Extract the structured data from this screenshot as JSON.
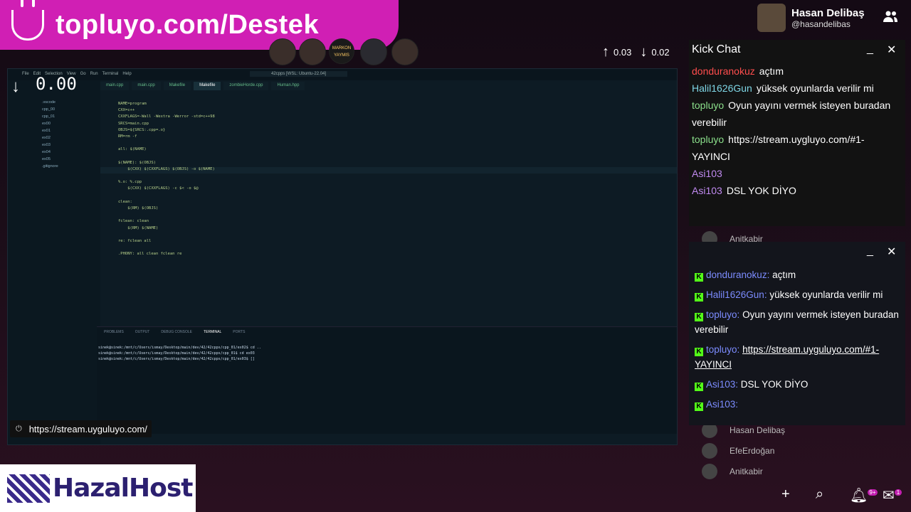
{
  "banner": {
    "text": "topluyo.com/Destek"
  },
  "profile": {
    "name": "Hasan Delibaş",
    "handle": "@hasandelibas"
  },
  "stats": {
    "up": "0.03",
    "down": "0.02"
  },
  "counter": "0.00",
  "url_overlay": "https://stream.uyguluyo.com/",
  "avatar_labels": {
    "third": "MARKON\nYAYMIS"
  },
  "vscode": {
    "title": "42cpps [WSL: Ubuntu-22.04]",
    "menu": [
      "File",
      "Edit",
      "Selection",
      "View",
      "Go",
      "Run",
      "Terminal",
      "Help"
    ],
    "tabs": [
      "main.cpp",
      "main.cpp",
      "Makefile",
      "Makefile",
      "zombieHorde.cpp",
      "Human.hpp"
    ],
    "active_tab_index": 3,
    "sidebar": [
      ".vscode",
      "cpp_00",
      "cpp_01",
      "ex00",
      "ex01",
      "ex02",
      "ex03",
      "ex04",
      "ex05",
      ".gitignore"
    ],
    "code": [
      "NAME=program",
      "CXX=c++",
      "CXXFLAGS=-Wall -Wextra -Werror -std=c++98",
      "SRCS=main.cpp",
      "OBJS=${SRCS:.cpp=.o}",
      "RM=rm -f",
      "",
      "all: $(NAME)",
      "",
      "$(NAME): $(OBJS)",
      "    $(CXX) $(CXXFLAGS) $(OBJS) -o $(NAME)",
      "",
      "%.o: %.cpp",
      "    $(CXX) $(CXXFLAGS) -c $< -o $@",
      "",
      "clean:",
      "    $(RM) $(OBJS)",
      "",
      "fclean: clean",
      "    $(RM) $(NAME)",
      "",
      "re: fclean all",
      "",
      ".PHONY: all clean fclean re"
    ],
    "panel_tabs": [
      "PROBLEMS",
      "OUTPUT",
      "DEBUG CONSOLE",
      "TERMINAL",
      "PORTS"
    ],
    "terminal": [
      "sinek@sinek:/mnt/c/Users/ismay/Desktop/main/dev/42/42cpps/cpp_01/ex02$ cd ..",
      "sinek@sinek:/mnt/c/Users/ismay/Desktop/main/dev/42/42cpps/cpp_01$ cd ex03",
      "sinek@sinek:/mnt/c/Users/ismay/Desktop/main/dev/42/42cpps/cpp_01/ex03$ []"
    ]
  },
  "kick_chat": {
    "title": "Kick Chat",
    "messages": [
      {
        "user": "donduranokuz",
        "color": "#ff4d4d",
        "text": "açtım"
      },
      {
        "user": "Halil1626Gun",
        "color": "#7fd7e6",
        "text": "yüksek oyunlarda verilir mi"
      },
      {
        "user": "topluyo",
        "color": "#8be08b",
        "text": "Oyun yayını vermek isteyen buradan verebilir"
      },
      {
        "user": "topluyo",
        "color": "#8be08b",
        "text": "https://stream.uygluyo.com/#1-YAYINCI"
      },
      {
        "user": "Asi103",
        "color": "#c08af0",
        "text": ""
      },
      {
        "user": "Asi103",
        "color": "#c08af0",
        "text": "DSL YOK DİYO"
      }
    ]
  },
  "kick_chat2": {
    "messages": [
      {
        "user": "donduranokuz",
        "text": "açtım"
      },
      {
        "user": "Halil1626Gun",
        "text": "yüksek oyunlarda verilir mi"
      },
      {
        "user": "topluyo",
        "text": "Oyun yayını vermek isteyen buradan verebilir"
      },
      {
        "user": "topluyo",
        "text": "https://stream.uyguluyo.com/#1-YAYINCI",
        "link": true
      },
      {
        "user": "Asi103",
        "text": "DSL YOK DİYO"
      },
      {
        "user": "Asi103",
        "text": ""
      }
    ]
  },
  "viewers": [
    "Anitkabir",
    "Hasan Delibaş",
    "EfeErdoğan",
    "Anitkabir"
  ],
  "logo": {
    "text": "HazalHost"
  },
  "notif_badge": "9+",
  "mail_badge": "1"
}
